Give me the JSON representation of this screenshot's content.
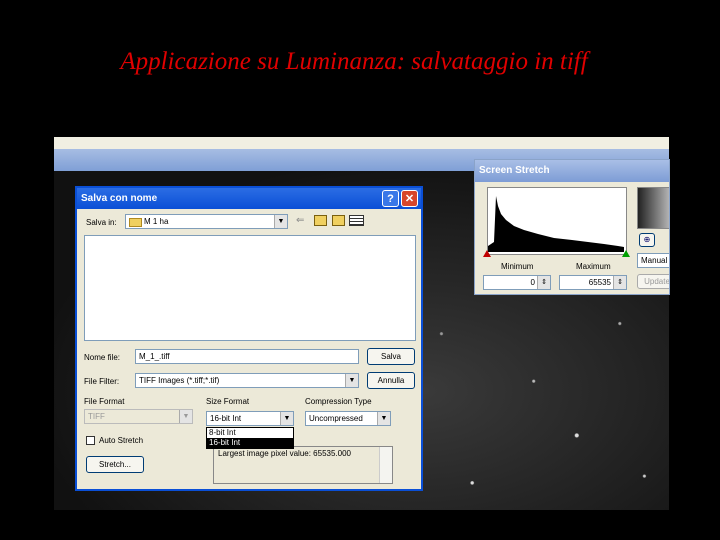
{
  "slide": {
    "title": "Applicazione  su Luminanza: salvataggio in tiff"
  },
  "dialog": {
    "title": "Salva con nome",
    "help_glyph": "?",
    "close_glyph": "✕",
    "save_in_label": "Salva in:",
    "save_in_value": "M 1 ha",
    "file_name_label": "Nome file:",
    "file_name_value": "M_1_.tiff",
    "save_button": "Salva",
    "file_filter_label": "File Filter:",
    "file_filter_value": "TIFF Images (*.tiff;*.tif)",
    "cancel_button": "Annulla",
    "file_format_label": "File Format",
    "file_format_value": "TIFF",
    "size_format_label": "Size Format",
    "size_format_value": "16-bit Int",
    "size_format_options": [
      "8-bit Int",
      "16-bit Int"
    ],
    "compression_label": "Compression Type",
    "compression_value": "Uncompressed",
    "auto_stretch_label": "Auto Stretch",
    "stretch_button": "Stretch...",
    "info_text": "Largest image pixel value: 65535.000"
  },
  "screen_stretch": {
    "title": "Screen Stretch",
    "minimum_label": "Minimum",
    "maximum_label": "Maximum",
    "minimum_value": "0",
    "maximum_value": "65535",
    "mode_value": "Manual",
    "update_button": "Update",
    "zoom_glyph": "⊕"
  },
  "colors": {
    "title_red": "#e00000",
    "xp_blue": "#0a4fd6",
    "dialog_bg": "#ece9d8"
  }
}
